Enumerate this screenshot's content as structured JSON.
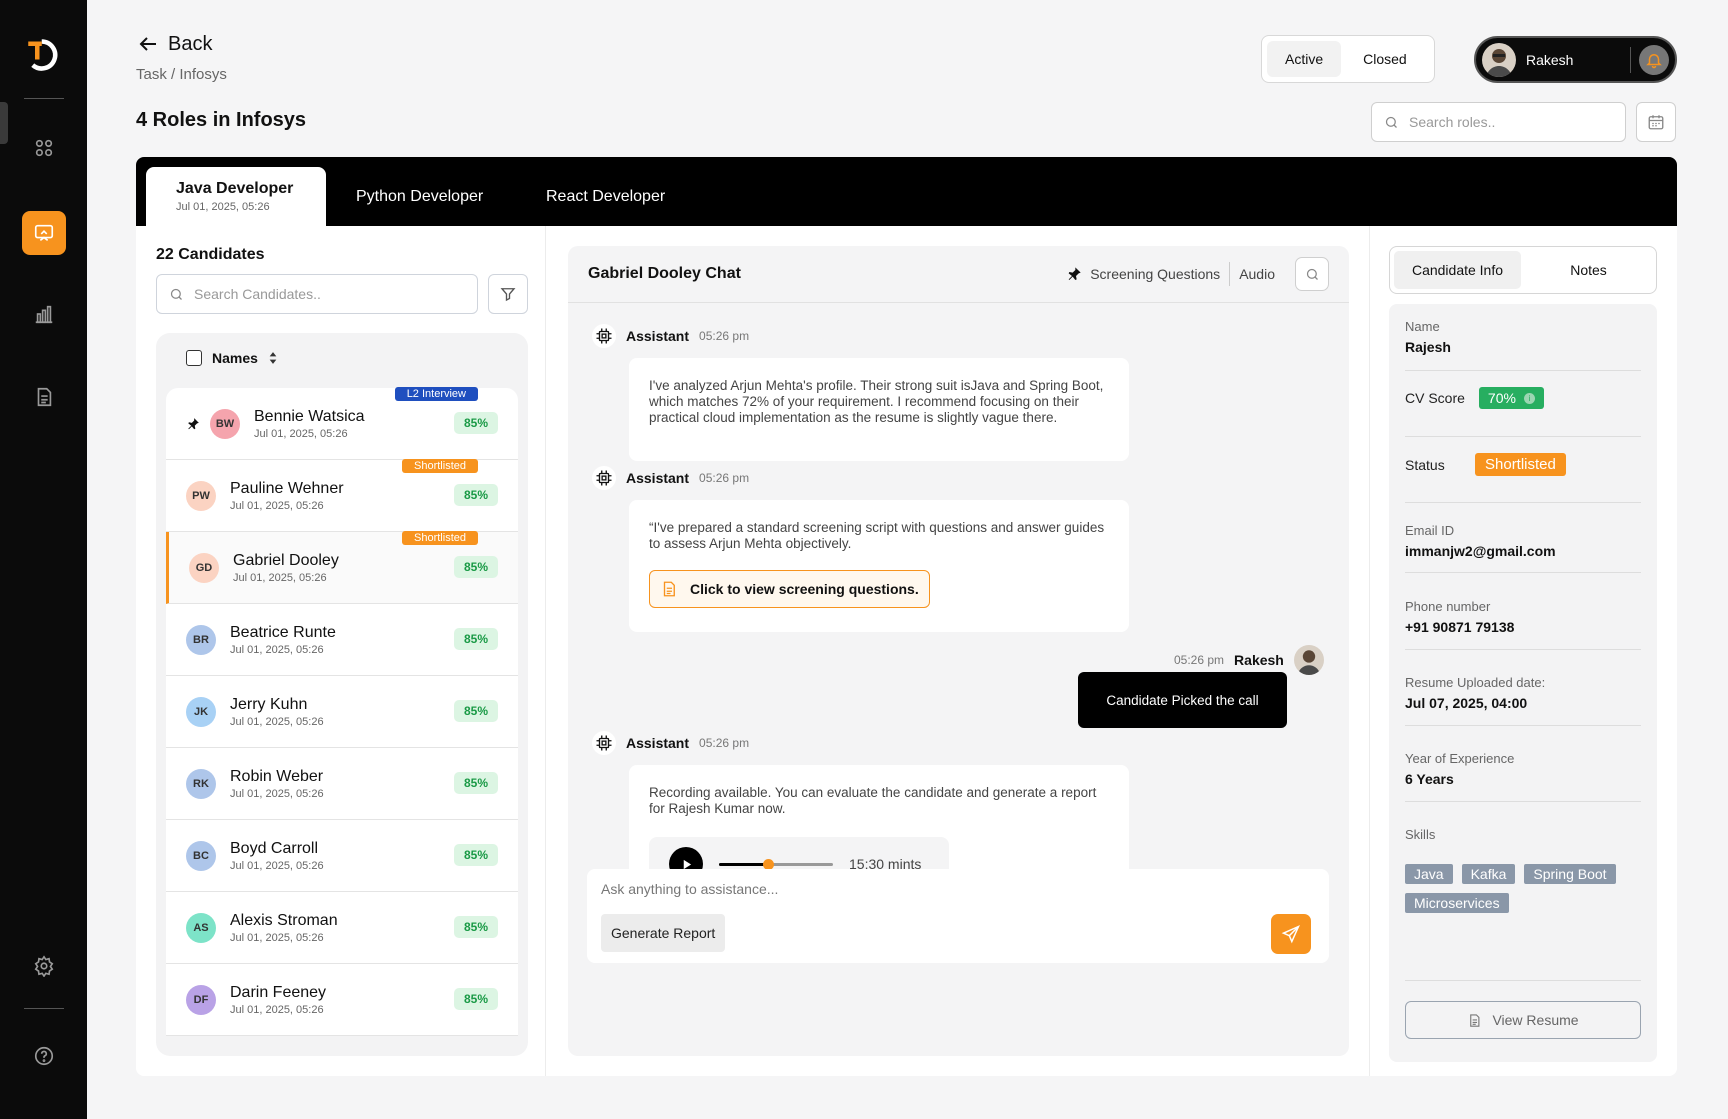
{
  "header": {
    "back_label": "Back",
    "breadcrumb": "Task / Infosys",
    "page_title": "4 Roles in Infosys",
    "status_options": [
      "Active",
      "Closed"
    ],
    "status_selected": "Active",
    "user_name": "Rakesh",
    "search_placeholder": "Search roles.."
  },
  "sidebar": {
    "active_item": "interviews",
    "items": [
      "logo-icon",
      "grid-icon",
      "presentation-icon",
      "bar-chart-icon",
      "document-icon",
      "settings-icon",
      "help-icon"
    ]
  },
  "role_tabs": [
    {
      "label": "Java Developer",
      "date": "Jul 01, 2025, 05:26",
      "active": true
    },
    {
      "label": "Python Developer"
    },
    {
      "label": "React Developer"
    }
  ],
  "candidates": {
    "count_label": "22 Candidates",
    "search_placeholder": "Search Candidates..",
    "names_header": "Names",
    "items": [
      {
        "initials": "BW",
        "name": "Bennie Watsica",
        "date": "Jul 01, 2025, 05:26",
        "score": "85%",
        "tag": "L2 Interview",
        "pinned": true,
        "avatar_color": "#f5a4ad"
      },
      {
        "initials": "PW",
        "name": "Pauline Wehner",
        "date": "Jul 01, 2025, 05:26",
        "score": "85%",
        "tag": "Shortlisted",
        "avatar_color": "#fbd3c2"
      },
      {
        "initials": "GD",
        "name": "Gabriel Dooley",
        "date": "Jul 01, 2025, 05:26",
        "score": "85%",
        "tag": "Shortlisted",
        "selected": true,
        "avatar_color": "#fbd3c2"
      },
      {
        "initials": "BR",
        "name": "Beatrice Runte",
        "date": "Jul 01, 2025, 05:26",
        "score": "85%",
        "avatar_color": "#aec6ea"
      },
      {
        "initials": "JK",
        "name": "Jerry Kuhn",
        "date": "Jul 01, 2025, 05:26",
        "score": "85%",
        "avatar_color": "#a8d1f5"
      },
      {
        "initials": "RK",
        "name": "Robin Weber",
        "date": "Jul 01, 2025, 05:26",
        "score": "85%",
        "avatar_color": "#aec6ea"
      },
      {
        "initials": "BC",
        "name": "Boyd Carroll",
        "date": "Jul 01, 2025, 05:26",
        "score": "85%",
        "avatar_color": "#aec6ea"
      },
      {
        "initials": "AS",
        "name": "Alexis Stroman",
        "date": "Jul 01, 2025, 05:26",
        "score": "85%",
        "avatar_color": "#7de3c8"
      },
      {
        "initials": "DF",
        "name": "Darin Feeney",
        "date": "Jul 01, 2025, 05:26",
        "score": "85%",
        "avatar_color": "#b9a2e6"
      }
    ]
  },
  "chat": {
    "title": "Gabriel Dooley Chat",
    "screening_label": "Screening Questions",
    "audio_label": "Audio",
    "messages": [
      {
        "sender": "Assistant",
        "time": "05:26 pm",
        "text": "I've analyzed Arjun Mehta's profile. Their strong suit isJava and Spring Boot, which matches 72% of your requirement. I recommend focusing on their practical cloud implementation as the resume is slightly vague there."
      },
      {
        "sender": "Assistant",
        "time": "05:26 pm",
        "text": "“I've prepared a standard screening script with questions and answer guides to assess Arjun Mehta objectively.",
        "button": "Click to view screening questions."
      },
      {
        "sender": "Rakesh",
        "time": "05:26 pm",
        "text": "Candidate Picked the call"
      },
      {
        "sender": "Assistant",
        "time": "05:26 pm",
        "text": "Recording available. You can evaluate the candidate and generate a report for Rajesh Kumar now.",
        "audio_duration": "15:30 mints",
        "audio_progress": 0.43
      }
    ],
    "composer_placeholder": "Ask anything to assistance...",
    "generate_label": "Generate Report"
  },
  "info": {
    "tabs": [
      "Candidate Info",
      "Notes"
    ],
    "active_tab": "Candidate Info",
    "name_label": "Name",
    "name_value": "Rajesh",
    "cv_label": "CV Score",
    "cv_value": "70%",
    "status_label": "Status",
    "status_value": "Shortlisted",
    "email_label": "Email ID",
    "email_value": "immanjw2@gmail.com",
    "phone_label": "Phone number",
    "phone_value": "+91 90871 79138",
    "resume_label": "Resume Uploaded date:",
    "resume_value": "Jul 07, 2025, 04:00",
    "exp_label": "Year of  Experience",
    "exp_value": "6 Years",
    "skills_label": "Skills",
    "skills": [
      "Java",
      "Kafka",
      "Spring Boot",
      "Microservices"
    ],
    "view_resume_label": "View Resume"
  },
  "colors": {
    "accent": "#f7931e",
    "score_green": "#1a9a46",
    "badge_blue": "#1f4fbf",
    "cv_green": "#27ae60"
  }
}
